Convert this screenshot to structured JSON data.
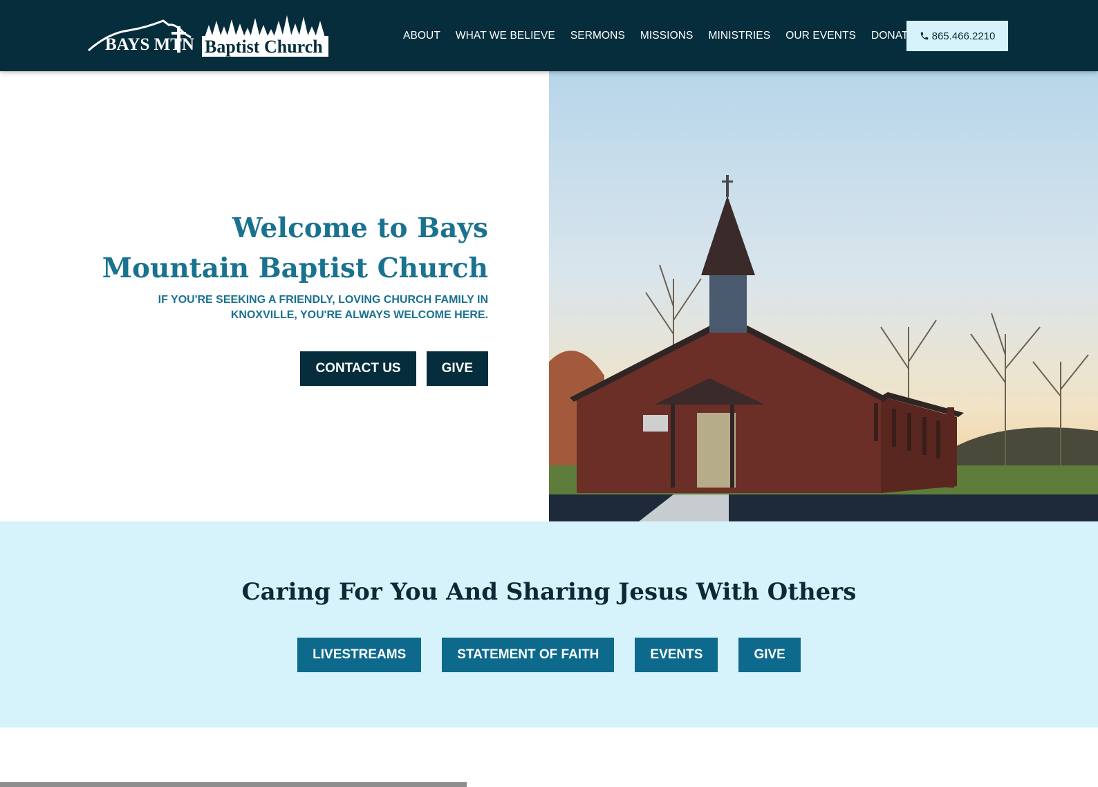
{
  "header": {
    "logo": {
      "text_left": "BAYS MTN",
      "text_right": "Baptist Church",
      "icon": "mountain-cross-trees-logo"
    },
    "nav": [
      "ABOUT",
      "WHAT WE BELIEVE",
      "SERMONS",
      "MISSIONS",
      "MINISTRIES",
      "OUR EVENTS",
      "DONATE"
    ],
    "phone": {
      "icon": "phone-icon",
      "label": "865.466.2210"
    }
  },
  "hero": {
    "title_line1": "Welcome to Bays",
    "title_line2": "Mountain Baptist Church",
    "subtitle_line1": "IF YOU'RE SEEKING A FRIENDLY, LOVING CHURCH FAMILY IN",
    "subtitle_line2": "KNOXVILLE, YOU'RE ALWAYS WELCOME HERE.",
    "buttons": [
      "CONTACT US",
      "GIVE"
    ],
    "image": "brick-church-with-steeple-photo"
  },
  "band": {
    "title": "Caring For You And Sharing Jesus With Others",
    "buttons": [
      "LIVESTREAMS",
      "STATEMENT OF FAITH",
      "EVENTS",
      "GIVE"
    ]
  },
  "colors": {
    "header_bg": "#062d3c",
    "accent_teal": "#19728f",
    "band_bg": "#d6f3fc",
    "button_teal": "#0e6a8d"
  }
}
